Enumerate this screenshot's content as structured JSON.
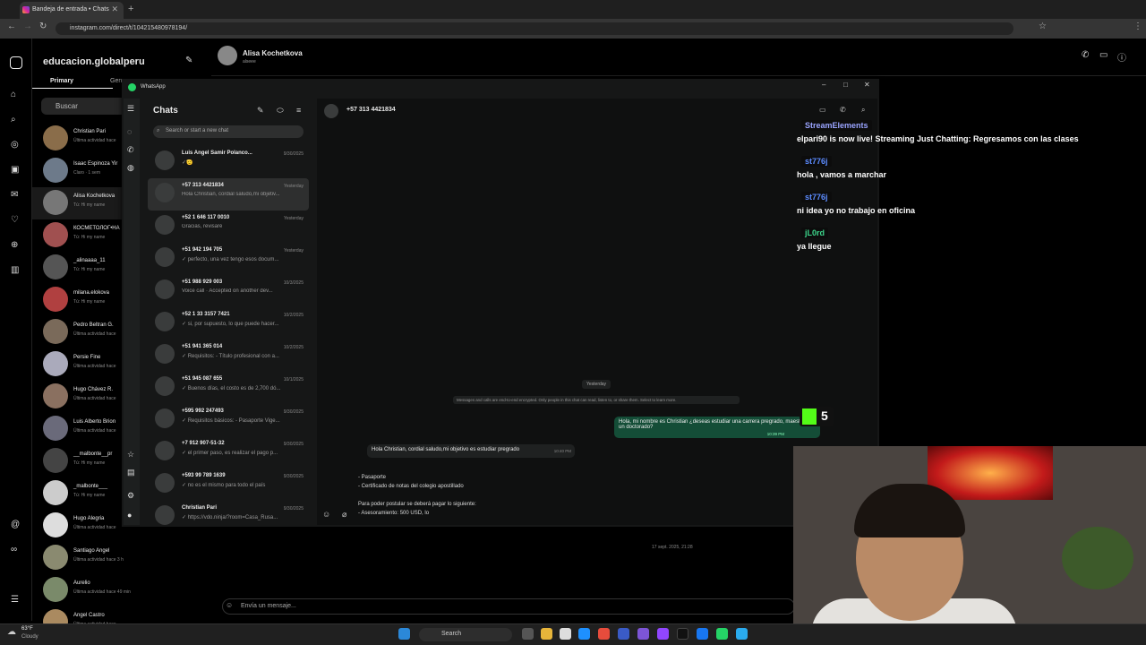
{
  "browser": {
    "tab_title": "Bandeja de entrada • Chats",
    "url": "instagram.com/direct/t/104215480978194/"
  },
  "instagram": {
    "account": "educacion.globalperu",
    "tabs": {
      "primary": "Primary",
      "general": "Gen"
    },
    "search_placeholder": "Buscar",
    "header_name": "Alisa Kochetkova",
    "header_handle": "alseee",
    "threads": [
      {
        "name": "Christian Pari",
        "sub": "Última actividad hace"
      },
      {
        "name": "Isaac Espinoza Yir",
        "sub": "Claro · 1 sem"
      },
      {
        "name": "Alisa Kochetkova",
        "sub": "Tú: Hi my name"
      },
      {
        "name": "КОСМЕТОЛОГ•НА",
        "sub": "Tú: Hi my name"
      },
      {
        "name": "_alinaaaa_11",
        "sub": "Tú: Hi my name"
      },
      {
        "name": "milana.elokova",
        "sub": "Tú: Hi my name"
      },
      {
        "name": "Pedro Beltran G.",
        "sub": "Última actividad hace"
      },
      {
        "name": "Persie Fine",
        "sub": "Última actividad hace"
      },
      {
        "name": "Hugo Chávez R.",
        "sub": "Última actividad hace"
      },
      {
        "name": "Luis Alberto Brion",
        "sub": "Última actividad hace"
      },
      {
        "name": "__malbonte__pr",
        "sub": "Tú: Hi my name"
      },
      {
        "name": "_malbonte___",
        "sub": "Tú: Hi my name"
      },
      {
        "name": "Hugo Alegria",
        "sub": "Última actividad hace"
      },
      {
        "name": "Santiago Angel",
        "sub": "Última actividad hace 3 h"
      },
      {
        "name": "Aurelio",
        "sub": "Última actividad hace 49 min"
      },
      {
        "name": "Angel Castro",
        "sub": "Última actividad hace"
      }
    ],
    "date_label": "17 sept. 2025, 21:28",
    "input_placeholder": "Envía un mensaje..."
  },
  "whatsapp": {
    "title": "WhatsApp",
    "chats_label": "Chats",
    "search_placeholder": "Search or start a new chat",
    "chats": [
      {
        "name": "Luis Angel Samir Polanco...",
        "time": "9/30/2025",
        "preview": "✓🫡"
      },
      {
        "name": "+57 313 4421834",
        "time": "Yesterday",
        "preview": "Hola Christian, cordial saludo,mi objetiv..."
      },
      {
        "name": "+52 1 646 117 0010",
        "time": "Yesterday",
        "preview": "Gracias, revisaré"
      },
      {
        "name": "+51 942 194 705",
        "time": "Yesterday",
        "preview": "✓ perfecto, una vez tengo esos docum..."
      },
      {
        "name": "+51 988 929 003",
        "time": "10/3/2025",
        "preview": "Voice call · Accepted on another dev..."
      },
      {
        "name": "+52 1 33 3157 7421",
        "time": "10/2/2025",
        "preview": "✓ si, por supuesto, lo que puede hacer..."
      },
      {
        "name": "+51 941 365 014",
        "time": "10/2/2025",
        "preview": "✓ Requisitos: - Título profesional con a..."
      },
      {
        "name": "+51 945 087 655",
        "time": "10/1/2025",
        "preview": "✓ Buenos días, el costo es de 2,700 dó..."
      },
      {
        "name": "+595 992 247493",
        "time": "9/30/2025",
        "preview": "✓ Requisitos básicos: - Pasaporte Vige..."
      },
      {
        "name": "+7 912 907-51-32",
        "time": "9/30/2025",
        "preview": "✓ el primer paso, es realizar el pago p..."
      },
      {
        "name": "+593 99 789 1639",
        "time": "9/30/2025",
        "preview": "✓ no es el mismo para todo el país"
      },
      {
        "name": "Christian Pari",
        "time": "9/30/2025",
        "preview": "✓ https://vdo.ninja/?room=Casa_Rusa..."
      }
    ],
    "active_chat": "+57 313 4421834",
    "day_label": "Yesterday",
    "encryption": "Messages and calls are end-to-end encrypted. Only people in this chat can read, listen to, or share them. Select to learn more.",
    "outgoing": "Hola, mi nombre es Christian ¿deseas estudiar una carrera pregrado, maestría o un doctorado?",
    "outgoing_time": "10:39 PM",
    "incoming": "Hola Christian, cordial saludo,mi objetivo es estudiar pregrado",
    "incoming_time": "10:40 PM",
    "compose": [
      "- Pasaporte",
      "- Certificado de notas del colegio apostillado",
      "",
      "Para poder postular se deberá pagar lo siguiente:",
      "- Asesoramiento: 500 USD, lo"
    ]
  },
  "stream_chat": [
    {
      "user": "StreamElements",
      "color": "#9aa4ff",
      "msg": "elpari90 is now live! Streaming Just Chatting: Regresamos con las clases"
    },
    {
      "user": "st776j",
      "color": "#5c8cff",
      "msg": "hola , vamos a marchar"
    },
    {
      "user": "st776j",
      "color": "#5c8cff",
      "msg": "ni idea yo no trabajo en oficina"
    },
    {
      "user": "jL0rd",
      "color": "#3dd68c",
      "msg": "ya llegue"
    }
  ],
  "kick_badge": "5",
  "taskbar": {
    "temp": "63°F",
    "condition": "Cloudy",
    "search": "Search"
  }
}
